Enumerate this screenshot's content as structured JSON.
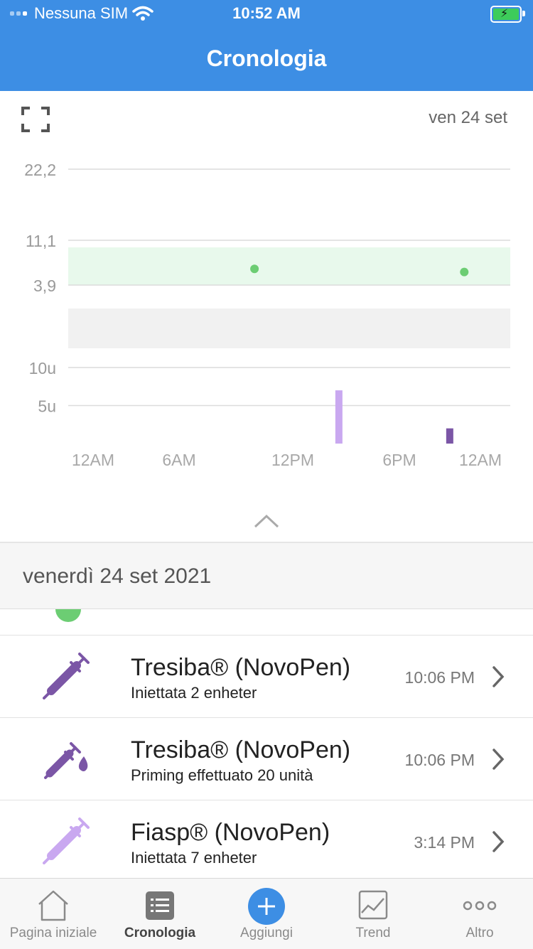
{
  "status_bar": {
    "carrier": "Nessuna SIM",
    "time": "10:52 AM"
  },
  "header": {
    "title": "Cronologia"
  },
  "chart_data": {
    "type": "scatter",
    "date_label": "ven 24 set",
    "glucose": {
      "ytick_labels": [
        "22,2",
        "11,1",
        "3,9"
      ],
      "target_range": [
        3.9,
        11.1
      ],
      "points": [
        {
          "time_h": 10.0,
          "value": 6.5
        },
        {
          "time_h": 23.0,
          "value": 6.0
        }
      ],
      "point_color": "#6ccd73",
      "target_band_color": "#e8f9ec"
    },
    "insulin": {
      "ytick_labels": [
        "10u",
        "5u"
      ],
      "bars": [
        {
          "time_h": 15.23,
          "units": 7,
          "color": "#c9a8f0",
          "label": "Fiasp"
        },
        {
          "time_h": 22.1,
          "units": 2,
          "color": "#7b56a6",
          "label": "Tresiba"
        }
      ]
    },
    "xtick_labels": [
      "12AM",
      "6AM",
      "12PM",
      "6PM",
      "12AM"
    ],
    "x_range_hours": [
      0,
      24
    ]
  },
  "section": {
    "title": "venerdì 24 set 2021"
  },
  "entries": [
    {
      "title": "Tresiba® (NovoPen)",
      "subtitle": "Iniettata 2 enheter",
      "time": "10:06 PM",
      "icon": "syringe-icon",
      "color": "#7b56a6"
    },
    {
      "title": "Tresiba® (NovoPen)",
      "subtitle": "Priming effettuato 20 unità",
      "time": "10:06 PM",
      "icon": "syringe-drop-icon",
      "color": "#7b56a6"
    },
    {
      "title": "Fiasp® (NovoPen)",
      "subtitle": "Iniettata 7 enheter",
      "time": "3:14 PM",
      "icon": "syringe-icon",
      "color": "#c9a8f0"
    }
  ],
  "tabbar": {
    "tabs": [
      {
        "label": "Pagina iniziale",
        "icon": "home-icon"
      },
      {
        "label": "Cronologia",
        "icon": "list-icon"
      },
      {
        "label": "Aggiungi",
        "icon": "add-icon"
      },
      {
        "label": "Trend",
        "icon": "trend-icon"
      },
      {
        "label": "Altro",
        "icon": "more-icon"
      }
    ],
    "active_index": 1,
    "accent": "#3d8ee4"
  }
}
